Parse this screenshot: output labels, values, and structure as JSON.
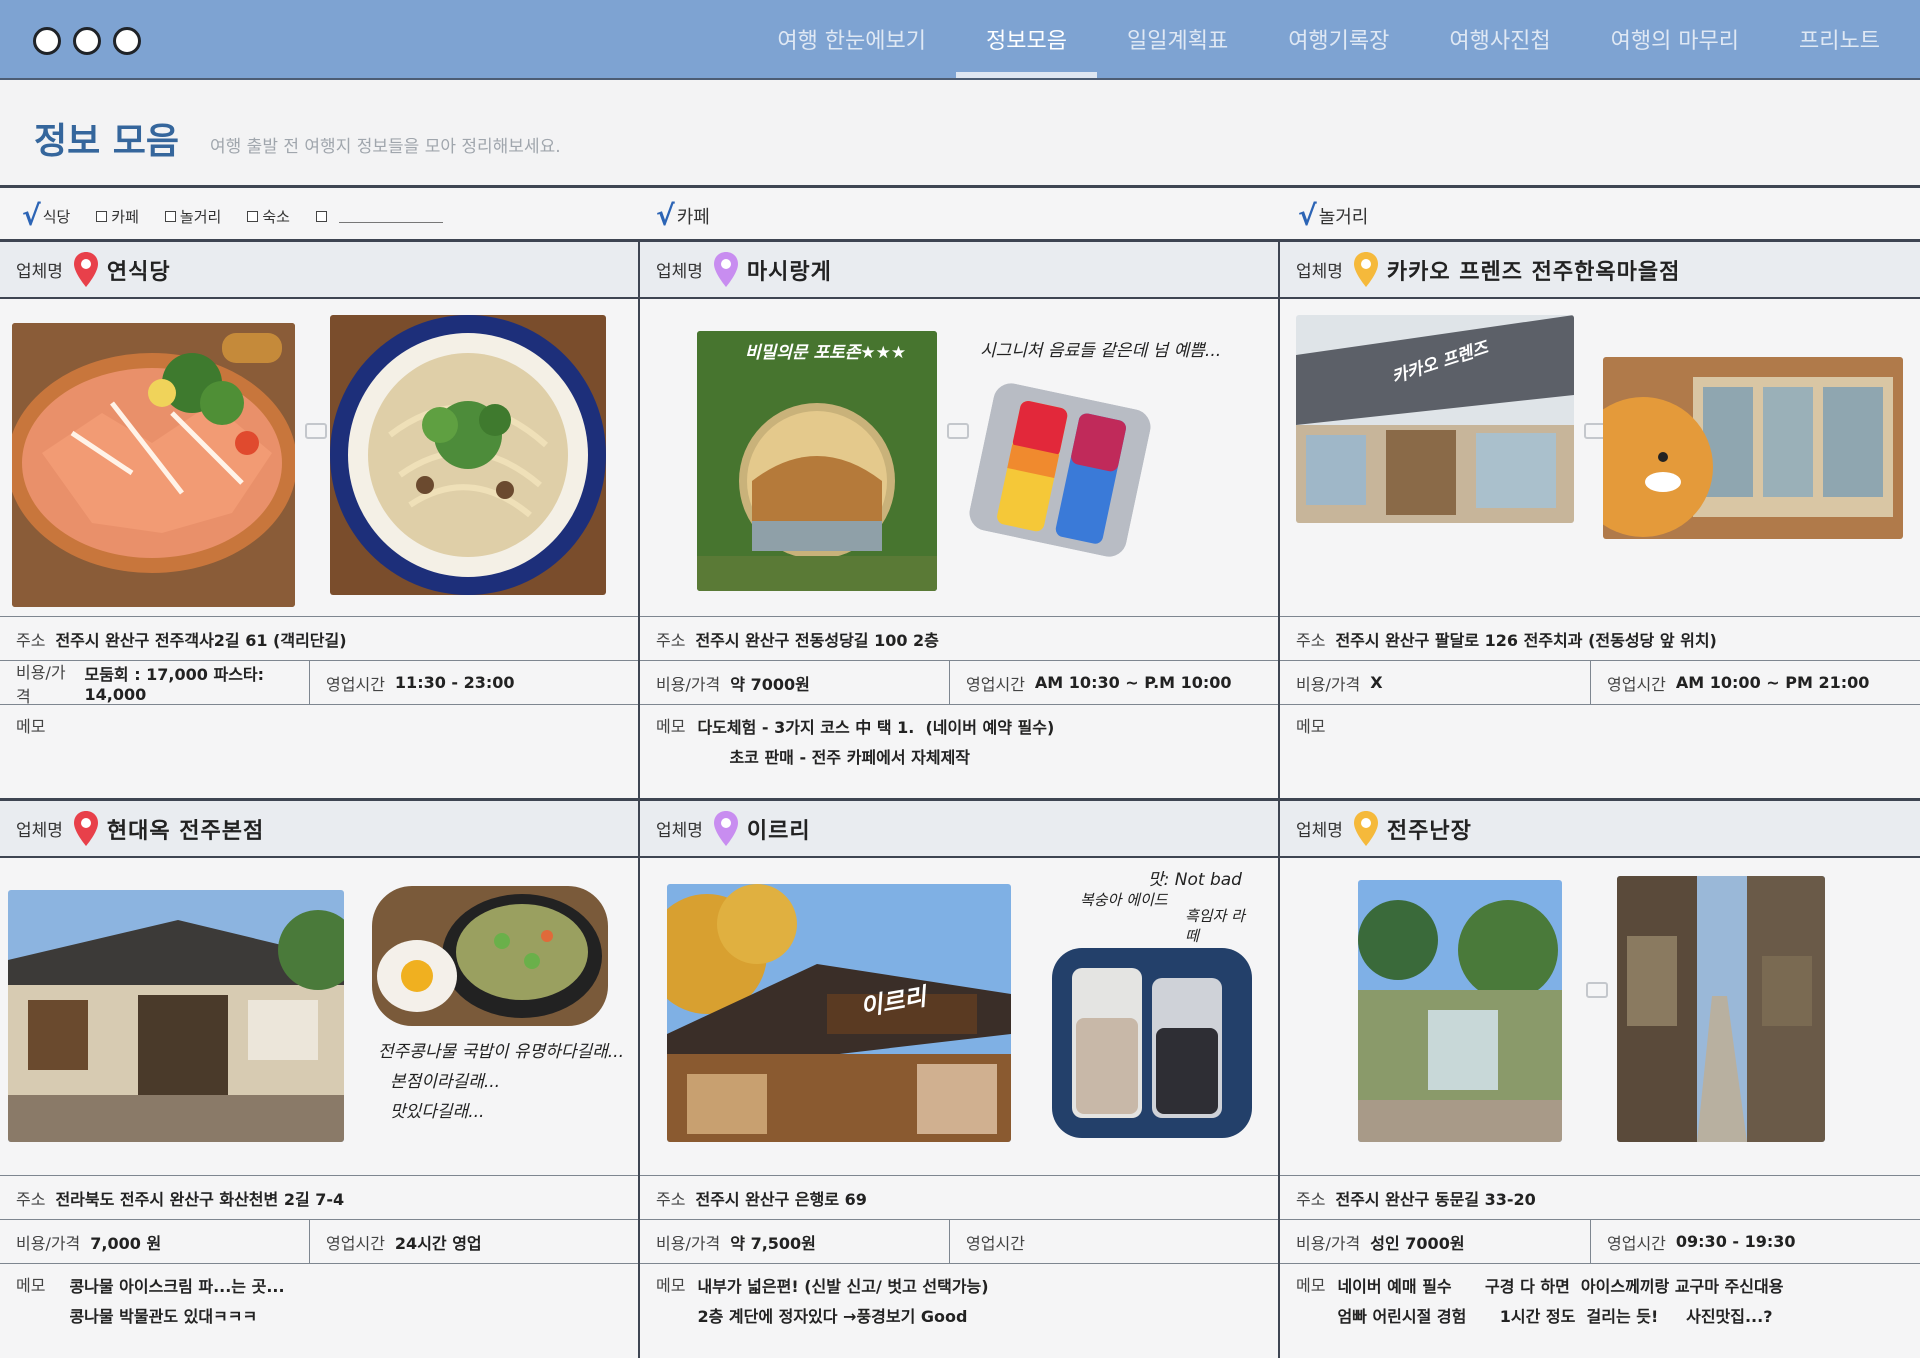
{
  "nav": {
    "tabs": [
      {
        "label": "여행 한눈에보기"
      },
      {
        "label": "정보모음"
      },
      {
        "label": "일일계획표"
      },
      {
        "label": "여행기록장"
      },
      {
        "label": "여행사진첩"
      },
      {
        "label": "여행의 마무리"
      },
      {
        "label": "프리노트"
      }
    ],
    "active_index": 1
  },
  "header": {
    "title": "정보 모음",
    "subtitle": "여행 출발 전 여행지 정보들을 모아 정리해보세요."
  },
  "filters": {
    "options": [
      "식당",
      "카페",
      "놀거리",
      "숙소"
    ],
    "checked": "식당",
    "col2": "카페",
    "col3": "놀거리"
  },
  "labels": {
    "name": "업체명",
    "address": "주소",
    "price": "비용/가격",
    "hours": "영업시간",
    "memo": "메모"
  },
  "colors": {
    "accent": "#7ea3d2",
    "pin_red": "#e8404a",
    "pin_purple": "#c88df0",
    "pin_yellow": "#f5b93b"
  },
  "cards": [
    {
      "name": "연식당",
      "address": "전주시 완산구 전주객사2길 61 (객리단길)",
      "price": "모둠회 : 17,000  파스타: 14,000",
      "hours": "11:30 - 23:00",
      "memo_1": "",
      "memo_2": "",
      "photo_left": "salmon-sashimi-photo",
      "photo_right": "cream-pasta-photo"
    },
    {
      "name": "마시랑게",
      "address": "전주시 완산구 전동성당길 100 2층",
      "price": "약 7000원",
      "hours": "AM 10:30 ~ P.M 10:00",
      "memo_1": "다도체험 - 3가지 코스 中 택 1.  (네이버 예약 필수)",
      "memo_2": "초코 판매 - 전주 카페에서 자체제작",
      "caption_1": "비밀의문 포토존★★★",
      "caption_2": "시그니처 음료들  같은데 넘 예쁨..."
    },
    {
      "name": "카카오 프렌즈  전주한옥마을점",
      "address": "전주시 완산구 팔달로  126  전주치과  (전동성당 앞 위치)",
      "price": "X",
      "hours": "AM 10:00 ~ PM 21:00",
      "memo_1": "",
      "memo_2": "",
      "sign": "카카오 프렌즈"
    },
    {
      "name": "현대옥  전주본점",
      "address": "전라북도 전주시 완산구 화산천변 2길 7-4",
      "price": "7,000 원",
      "hours": "24시간 영업",
      "memo_1": "콩나물 아이스크림 파...는 곳...",
      "memo_2": "콩나물 박물관도 있대ㅋㅋㅋ",
      "caption_1": "전주콩나물 국밥이 유명하다길래...",
      "caption_2": "본점이라길래...",
      "caption_3": "맛있다길래..."
    },
    {
      "name": "이르리",
      "address": "전주시 완산구 은행로 69",
      "price": "약 7,500원",
      "hours": "",
      "memo_1": "내부가 넓은편! (신발 신고/ 벗고 선택가능)",
      "memo_2": "2층 계단에 정자있다 →풍경보기 Good",
      "sign": "이르리",
      "caption_1": "맛: Not bad",
      "caption_2": "복숭아 에이드",
      "caption_3": "흑임자 라떼"
    },
    {
      "name": "전주난장",
      "address": "전주시 완산구 동문길 33-20",
      "price": "성인 7000원",
      "hours": "09:30  - 19:30",
      "memo_1": "네이버 예매 필수      구경 다 하면  아이스께끼랑 교구마 주신대용",
      "memo_2": "엄빠 어린시절 경험      1시간 정도  걸리는 듯!     사진맛집...?"
    }
  ]
}
